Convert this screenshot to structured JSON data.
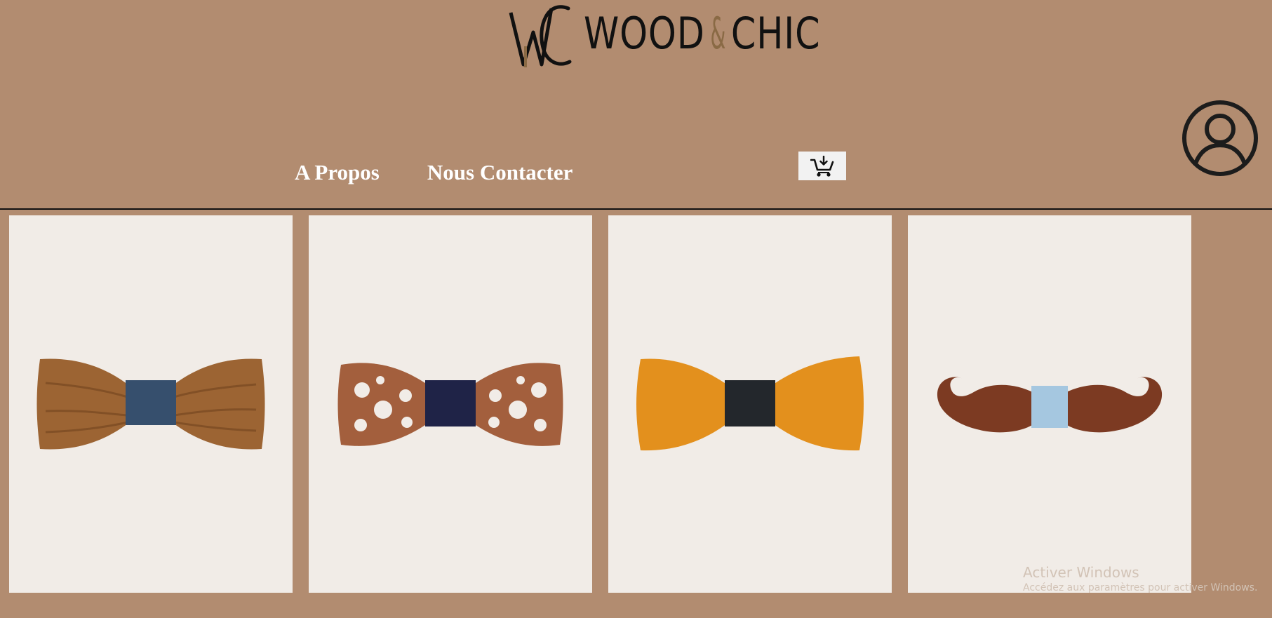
{
  "brand": {
    "name_left": "WOOD",
    "name_amp": "&",
    "name_right": "CHIC",
    "monogram": "WC",
    "colors": {
      "ink": "#111111",
      "gold": "#8a6a45"
    }
  },
  "nav": {
    "items": [
      {
        "label": "A Propos"
      },
      {
        "label": "Nous Contacter"
      }
    ]
  },
  "header": {
    "cart_icon": "cart-download-icon",
    "account_icon": "user-circle-icon"
  },
  "products": [
    {
      "name": "zebrawood-bow-tie",
      "wood": "#9c6433",
      "center": "#364f6d"
    },
    {
      "name": "filigree-bow-tie",
      "wood": "#a35f3d",
      "center": "#1f2347"
    },
    {
      "name": "orange-wood-bow-tie",
      "wood": "#e3901d",
      "center": "#23272c"
    },
    {
      "name": "mustache-bow-tie",
      "wood": "#7c3a22",
      "center": "#a5c7e0"
    }
  ],
  "watermark": {
    "title": "Activer Windows",
    "subtitle": "Accédez aux paramètres pour activer Windows."
  },
  "theme": {
    "background": "#b28c70",
    "card_background": "#f1ece7",
    "nav_text": "#ffffff"
  }
}
